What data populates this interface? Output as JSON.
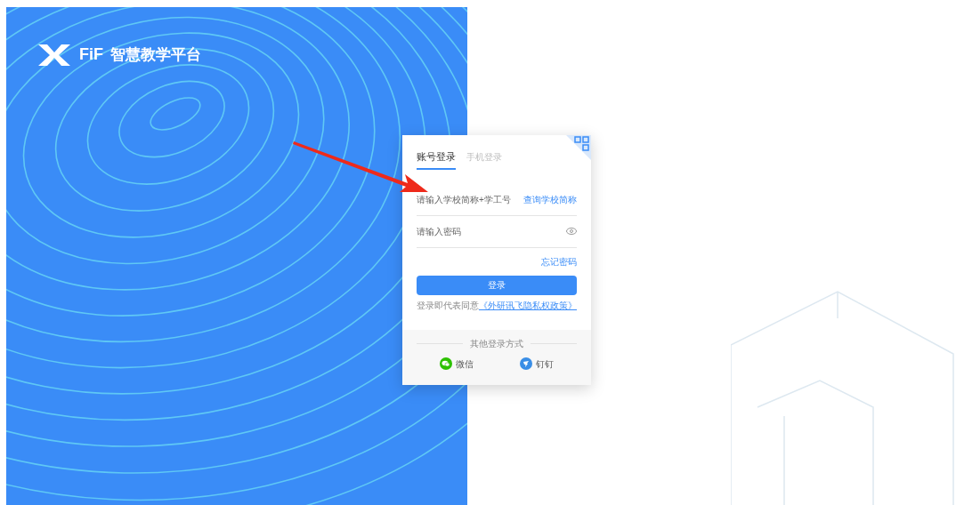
{
  "brand": {
    "mark": "FiF",
    "name": "智慧教学平台"
  },
  "login": {
    "tabs": [
      {
        "label": "账号登录",
        "selected": true
      },
      {
        "label": "手机登录",
        "selected": false
      }
    ],
    "account": {
      "placeholder": "请输入学校简称+学工号",
      "link": "查询学校简称"
    },
    "password": {
      "placeholder": "请输入密码"
    },
    "forgot": "忘记密码",
    "submit": "登录",
    "agreement": {
      "text": "登录即代表同意",
      "link": "《外研讯飞隐私权政策》"
    },
    "other": {
      "title": "其他登录方式",
      "methods": [
        {
          "kind": "wechat",
          "label": "微信"
        },
        {
          "kind": "dingtalk",
          "label": "钉钉"
        }
      ]
    }
  }
}
